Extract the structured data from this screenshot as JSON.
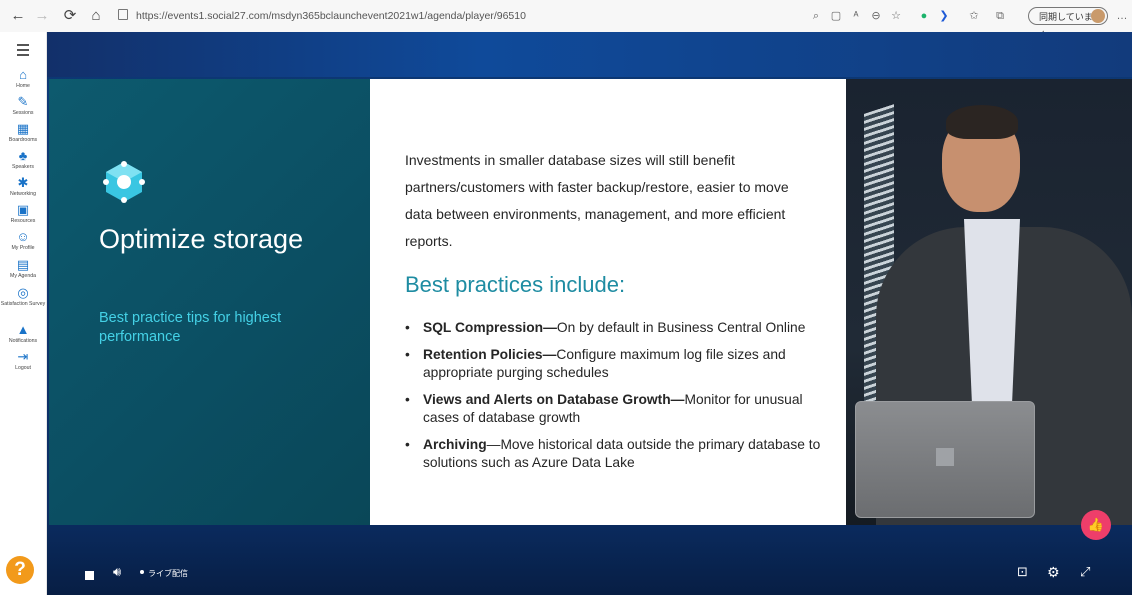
{
  "browser": {
    "url": "https://events1.social27.com/msdyn365bclaunchevent2021w1/agenda/player/96510",
    "sync_label": "同期していません"
  },
  "sidebar": {
    "items": [
      {
        "label": "Home",
        "icon": "home-icon"
      },
      {
        "label": "Sessions",
        "icon": "pencil-icon"
      },
      {
        "label": "Boardrooms",
        "icon": "boardroom-icon"
      },
      {
        "label": "Speakers",
        "icon": "speaker-icon"
      },
      {
        "label": "Networking",
        "icon": "network-icon"
      },
      {
        "label": "Resources",
        "icon": "resources-icon"
      },
      {
        "label": "My Profile",
        "icon": "profile-icon"
      },
      {
        "label": "My Agenda",
        "icon": "agenda-icon"
      },
      {
        "label": "Satisfaction Survey",
        "icon": "survey-icon"
      },
      {
        "label": "Notifications",
        "icon": "bell-icon"
      },
      {
        "label": "Logout",
        "icon": "logout-icon"
      }
    ],
    "help_label": "?"
  },
  "slide": {
    "title": "Optimize storage",
    "subtitle": "Best practice tips for highest performance",
    "intro": "Investments in smaller database sizes will still benefit partners/customers with faster backup/restore, easier to move data between environments, management, and more efficient reports.",
    "heading": "Best practices include:",
    "bullets": [
      {
        "bold": "SQL Compression—",
        "text": "On by default in Business Central Online"
      },
      {
        "bold": "Retention Policies—",
        "text": "Configure maximum log file sizes and appropriate purging schedules"
      },
      {
        "bold": "Views and Alerts on Database Growth—",
        "text": "Monitor for unusual cases of database growth"
      },
      {
        "bold": "Archiving",
        "text": "—Move historical data outside the primary database to solutions such as Azure Data Lake"
      }
    ]
  },
  "player": {
    "live_label": "ライブ配信"
  },
  "colors": {
    "accent_cyan": "#44d1e6",
    "heading_teal": "#1e8ca2",
    "like_pink": "#ee3e6a",
    "help_orange": "#f29a1b"
  }
}
